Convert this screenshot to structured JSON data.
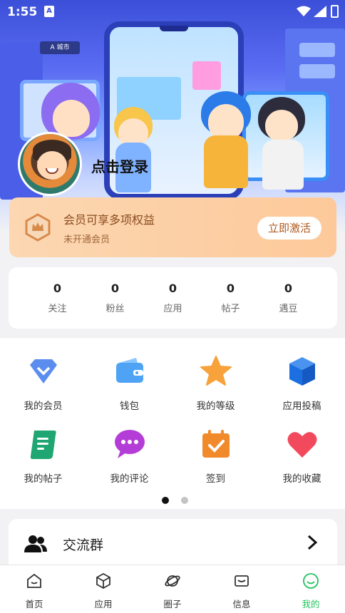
{
  "status_bar": {
    "time": "1:55",
    "app_icon_label": "A"
  },
  "hero": {
    "sign_text": "A 城市",
    "login_text": "点击登录"
  },
  "member": {
    "title": "会员可享多项权益",
    "subtitle": "未开通会员",
    "button": "立即激活"
  },
  "stats": [
    {
      "value": "0",
      "label": "关注"
    },
    {
      "value": "0",
      "label": "粉丝"
    },
    {
      "value": "0",
      "label": "应用"
    },
    {
      "value": "0",
      "label": "帖子"
    },
    {
      "value": "0",
      "label": "遇豆"
    }
  ],
  "grid": [
    {
      "label": "我的会员",
      "icon": "diamond-icon",
      "color": "#5b8def"
    },
    {
      "label": "钱包",
      "icon": "wallet-icon",
      "color": "#4ea3f5"
    },
    {
      "label": "我的等级",
      "icon": "star-icon",
      "color": "#f7a23b"
    },
    {
      "label": "应用投稿",
      "icon": "cube-icon",
      "color": "#1b6fe0"
    },
    {
      "label": "我的帖子",
      "icon": "scroll-icon",
      "color": "#1fa672"
    },
    {
      "label": "我的评论",
      "icon": "comment-icon",
      "color": "#b33dd6"
    },
    {
      "label": "签到",
      "icon": "calendar-check-icon",
      "color": "#f08a2a"
    },
    {
      "label": "我的收藏",
      "icon": "heart-icon",
      "color": "#f24a5c"
    }
  ],
  "pager": {
    "active": 0,
    "count": 2
  },
  "group_row": {
    "label": "交流群"
  },
  "tabs": [
    {
      "label": "首页",
      "icon": "home-icon"
    },
    {
      "label": "应用",
      "icon": "box-icon"
    },
    {
      "label": "圈子",
      "icon": "planet-icon"
    },
    {
      "label": "信息",
      "icon": "message-icon"
    },
    {
      "label": "我的",
      "icon": "smile-icon",
      "active": true
    }
  ],
  "colors": {
    "accent": "#22c35e",
    "member_text": "#8a4b1f",
    "member_bg": "#fdd0a6"
  }
}
